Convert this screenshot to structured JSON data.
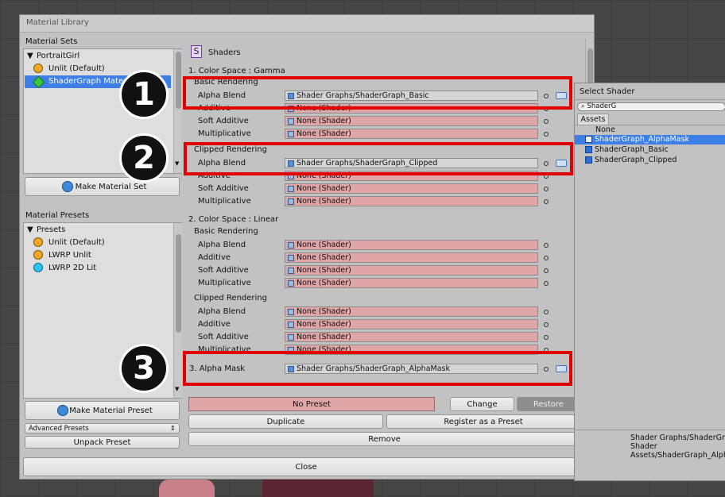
{
  "window": {
    "title": "Material Library"
  },
  "material_sets": {
    "header": "Material Sets",
    "root": "PortraitGirl",
    "items": [
      "Unlit (Default)",
      "ShaderGraph Material"
    ],
    "button": "Make Material Set"
  },
  "material_presets": {
    "header": "Material Presets",
    "root": "Presets",
    "items": [
      "Unlit (Default)",
      "LWRP Unlit",
      "LWRP 2D Lit"
    ],
    "button": "Make Material Preset",
    "advanced": "Advanced Presets",
    "unpack": "Unpack Preset"
  },
  "shaders": {
    "header": "Shaders",
    "icon_letter": "S",
    "gamma": {
      "title": "1. Color Space : Gamma",
      "basic": {
        "title": "Basic Rendering",
        "rows": [
          {
            "label": "Alpha Blend",
            "value": "Shader Graphs/ShaderGraph_Basic"
          },
          {
            "label": "Additive",
            "value": "None (Shader)"
          },
          {
            "label": "Soft Additive",
            "value": "None (Shader)"
          },
          {
            "label": "Multiplicative",
            "value": "None (Shader)"
          }
        ]
      },
      "clipped": {
        "title": "Clipped Rendering",
        "rows": [
          {
            "label": "Alpha Blend",
            "value": "Shader Graphs/ShaderGraph_Clipped"
          },
          {
            "label": "Additive",
            "value": "None (Shader)"
          },
          {
            "label": "Soft Additive",
            "value": "None (Shader)"
          },
          {
            "label": "Multiplicative",
            "value": "None (Shader)"
          }
        ]
      }
    },
    "linear": {
      "title": "2. Color Space : Linear",
      "basic": {
        "title": "Basic Rendering",
        "rows": [
          {
            "label": "Alpha Blend",
            "value": "None (Shader)"
          },
          {
            "label": "Additive",
            "value": "None (Shader)"
          },
          {
            "label": "Soft Additive",
            "value": "None (Shader)"
          },
          {
            "label": "Multiplicative",
            "value": "None (Shader)"
          }
        ]
      },
      "clipped": {
        "title": "Clipped Rendering",
        "rows": [
          {
            "label": "Alpha Blend",
            "value": "None (Shader)"
          },
          {
            "label": "Additive",
            "value": "None (Shader)"
          },
          {
            "label": "Soft Additive",
            "value": "None (Shader)"
          },
          {
            "label": "Multiplicative",
            "value": "None (Shader)"
          }
        ]
      }
    },
    "alpha_mask": {
      "label": "3. Alpha Mask",
      "value": "Shader Graphs/ShaderGraph_AlphaMask"
    }
  },
  "actions": {
    "preset": "No Preset",
    "change": "Change",
    "restore": "Restore",
    "duplicate": "Duplicate",
    "register": "Register as a Preset",
    "remove": "Remove",
    "close": "Close"
  },
  "badges": [
    "1",
    "2",
    "3"
  ],
  "select_shader": {
    "title": "Select Shader",
    "search": "ShaderG",
    "tab": "Assets",
    "items": [
      "None",
      "ShaderGraph_AlphaMask",
      "ShaderGraph_Basic",
      "ShaderGraph_Clipped"
    ],
    "selected_index": 1,
    "info": [
      "Shader Graphs/ShaderGra",
      "Shader",
      "Assets/ShaderGraph_Alph"
    ]
  },
  "colors": {
    "highlight": "#e00000",
    "none_field": "#e0a5a6",
    "selection": "#3d7fe6"
  }
}
